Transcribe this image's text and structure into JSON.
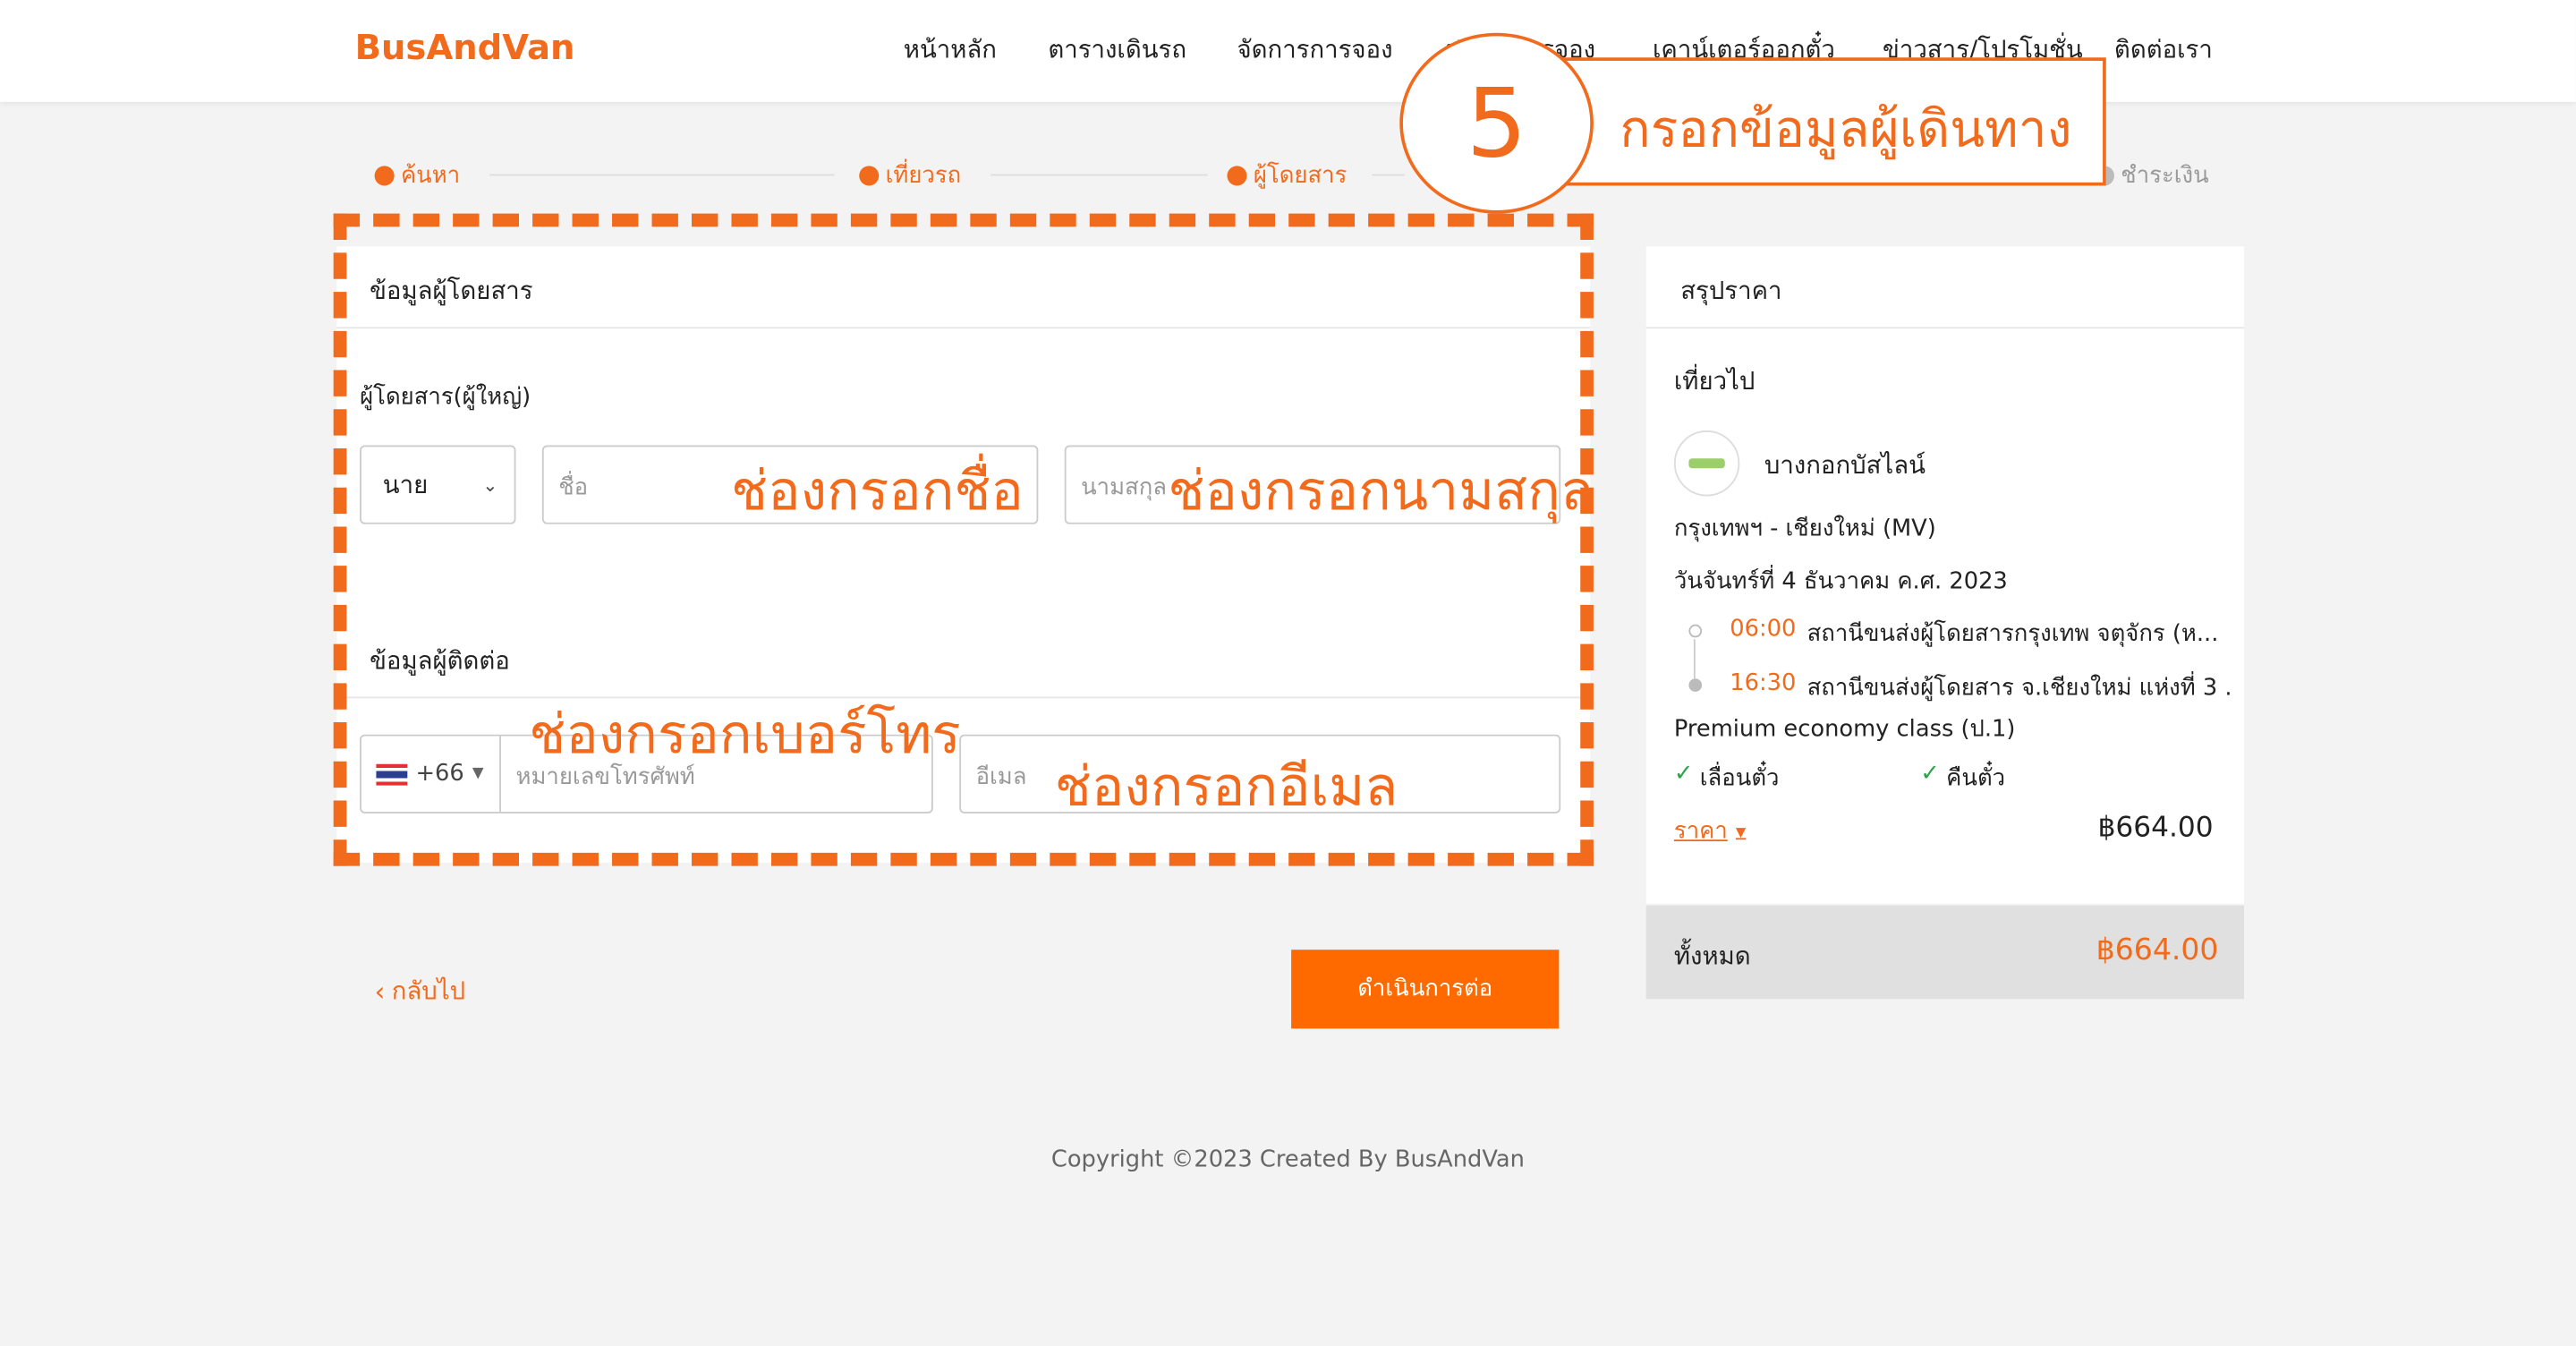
{
  "header": {
    "brand": "BusAndVan",
    "nav": [
      "หน้าหลัก",
      "ตารางเดินรถ",
      "จัดการการจอง",
      "ป",
      "รจอง",
      "เคาน์เตอร์ออกตั๋ว",
      "ข่าวสาร/โปรโมชั่น",
      "ติดต่อเรา"
    ]
  },
  "stepper": {
    "steps": [
      {
        "label": "ค้นหา",
        "active": true
      },
      {
        "label": "เที่ยวรถ",
        "active": true
      },
      {
        "label": "ผู้โดยสาร",
        "active": true
      },
      {
        "label": "ชำระเงิน",
        "active": false
      }
    ]
  },
  "callout": {
    "number": "5",
    "text": "กรอกข้อมูลผู้เดินทาง"
  },
  "passenger": {
    "section_title": "ข้อมูลผู้โดยสาร",
    "group_label": "ผู้โดยสาร(ผู้ใหญ่)",
    "title_select": "นาย",
    "first_name_placeholder": "ชื่อ",
    "last_name_placeholder": "นามสกุล",
    "first_name_annotation": "ช่องกรอกชื่อ",
    "last_name_annotation": "ช่องกรอกนามสกุล"
  },
  "contact": {
    "section_title": "ข้อมูลผู้ติดต่อ",
    "country_code": "+66",
    "phone_placeholder": "หมายเลขโทรศัพท์",
    "email_placeholder": "อีเมล",
    "phone_annotation": "ช่องกรอกเบอร์โทร",
    "email_annotation": "ช่องกรอกอีเมล"
  },
  "actions": {
    "back_label": "กลับไป",
    "next_label": "ดำเนินการต่อ"
  },
  "summary": {
    "title": "สรุปราคา",
    "trip_label": "เที่ยวไป",
    "operator": "บางกอกบัสไลน์",
    "route": "กรุงเทพฯ - เชียงใหม่ (MV)",
    "date": "วันจันทร์ที่ 4 ธันวาคม ค.ศ. 2023",
    "depart_time": "06:00",
    "depart_station": "สถานีขนส่งผู้โดยสารกรุงเทพ จตุจักร (ห...",
    "arrive_time": "16:30",
    "arrive_station": "สถานีขนส่งผู้โดยสาร จ.เชียงใหม่ แห่งที่ 3 ...",
    "class": "Premium economy class (ป.1)",
    "feature_1": "เลื่อนตั๋ว",
    "feature_2": "คืนตั๋ว",
    "price_label": "ราคา",
    "price": "฿664.00",
    "total_label": "ทั้งหมด",
    "total": "฿664.00"
  },
  "footer": {
    "copyright": "Copyright ©2023 Created By BusAndVan"
  },
  "colors": {
    "brand": "#f26a1b",
    "button": "#ff6a00",
    "check": "#2aa34a"
  }
}
